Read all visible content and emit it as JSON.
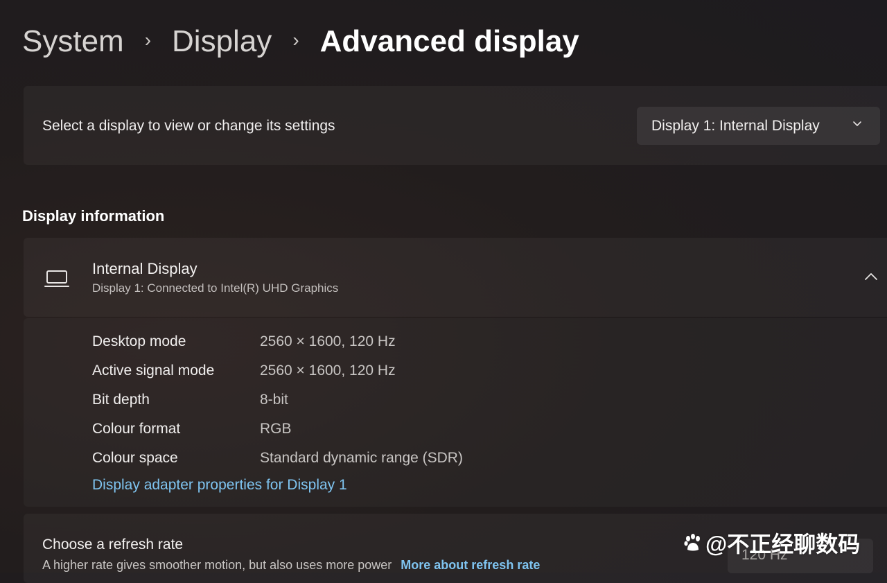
{
  "breadcrumb": {
    "items": [
      "System",
      "Display",
      "Advanced display"
    ],
    "separator": "›"
  },
  "display_select": {
    "label": "Select a display to view or change its settings",
    "selected": "Display 1: Internal Display"
  },
  "display_information": {
    "heading": "Display information",
    "display_name": "Internal Display",
    "display_subtitle": "Display 1: Connected to Intel(R) UHD Graphics",
    "rows": [
      {
        "label": "Desktop mode",
        "value": "2560 × 1600, 120 Hz"
      },
      {
        "label": "Active signal mode",
        "value": "2560 × 1600, 120 Hz"
      },
      {
        "label": "Bit depth",
        "value": "8-bit"
      },
      {
        "label": "Colour format",
        "value": "RGB"
      },
      {
        "label": "Colour space",
        "value": "Standard dynamic range (SDR)"
      }
    ],
    "adapter_link": "Display adapter properties for Display 1"
  },
  "refresh_rate": {
    "title": "Choose a refresh rate",
    "description": "A higher rate gives smoother motion, but also uses more power",
    "link": "More about refresh rate",
    "selected": "120 Hz"
  },
  "watermark": {
    "text": "@不正经聊数码"
  },
  "icons": {
    "monitor": "laptop-icon",
    "dropdown": "chevron-down-icon",
    "collapse": "chevron-up-icon"
  },
  "colors": {
    "link": "#7fc4f0",
    "background": "#221d1d"
  }
}
